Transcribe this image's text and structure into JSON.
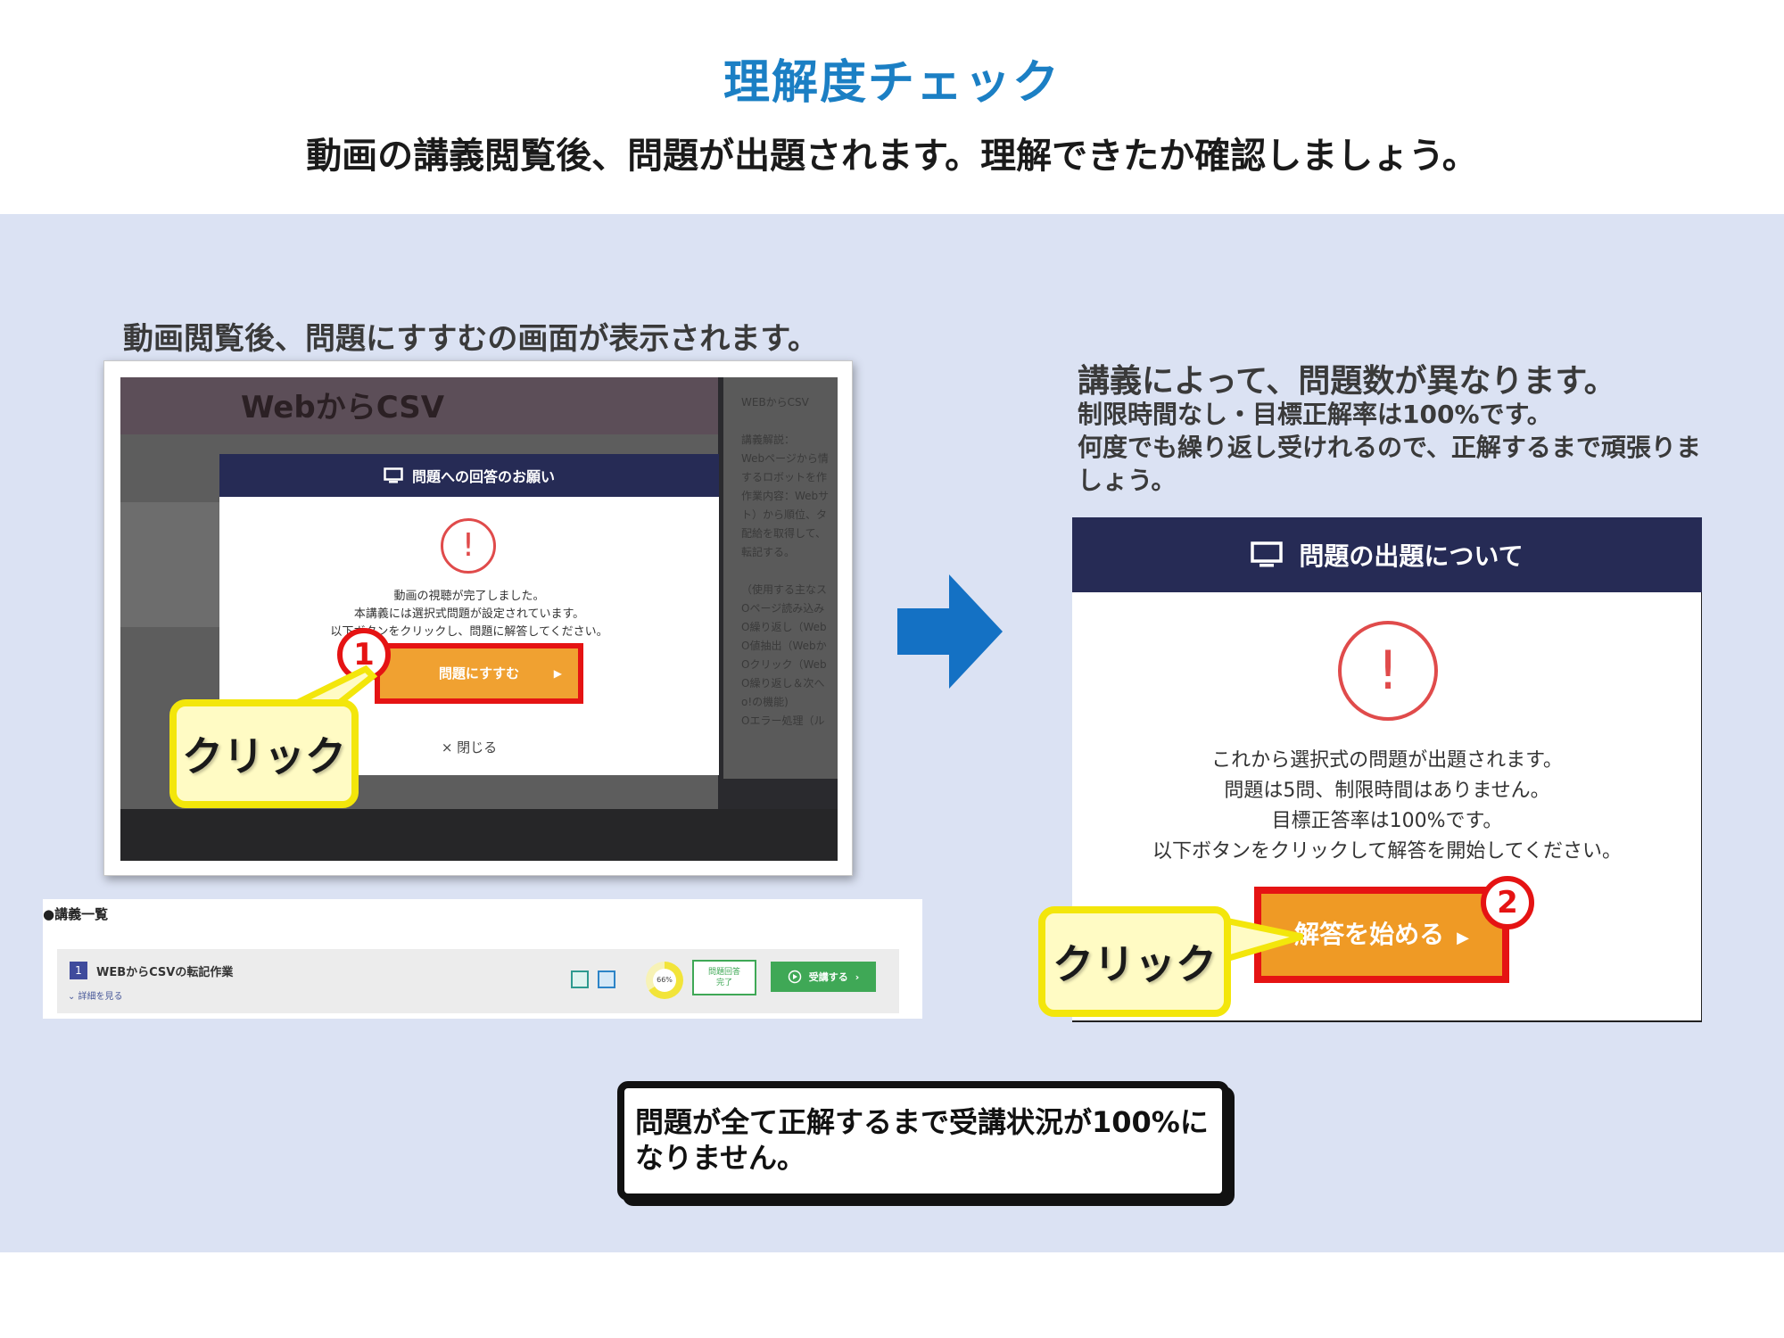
{
  "header": {
    "title": "理解度チェック",
    "subtitle": "動画の講義閲覧後、問題が出題されます。理解できたか確認しましょう。"
  },
  "left": {
    "label": "動画閲覧後、問題にすすむの画面が表示されます。",
    "bg_title": "WebからCSV",
    "bg_side_text": "WEBからCSV\n\n講義解説：\nWebページから情\nするロボットを作\n作業内容：Webサ\nト）から順位、タ\n配給を取得して、\n転記する。\n\n（使用する主なス\nOページ読み込み\nO繰り返し（Web\nO値抽出（Webか\nOクリック（Web\nO繰り返し＆次へ\no!の機能)\nOエラー処理（ル",
    "modal": {
      "header": "問題への回答のお願い",
      "icon": "!",
      "message": [
        "動画の視聴が完了しました。",
        "本講義には選択式問題が設定されています。",
        "以下ボタンをクリックし、問題に解答してください。"
      ],
      "button": "問題にすすむ",
      "close": "× 閉じる"
    },
    "step": "1",
    "callout": "クリック"
  },
  "list": {
    "heading": "●講義一覧",
    "row": {
      "number": "1",
      "title": "WEBからCSVの転記作業",
      "detail": "⌄ 詳細を見る",
      "progress": "66%",
      "progress_value": 0.66,
      "done": "問題回答\n完了",
      "start": "受講する"
    }
  },
  "right": {
    "title": "講義によって、問題数が異なります。",
    "desc": [
      "制限時間なし・目標正解率は100%です。",
      "何度でも繰り返し受けれるので、正解するまで頑張りましょう。"
    ],
    "modal": {
      "header": "問題の出題について",
      "icon": "!",
      "message": [
        "これから選択式の問題が出題されます。",
        "問題は5問、制限時間はありません。",
        "目標正答率は100%です。",
        "以下ボタンをクリックして解答を開始してください。"
      ],
      "button": "解答を始める"
    },
    "step": "2",
    "callout": "クリック"
  },
  "note": "問題が全て正解するまで受講状況が100%になりません。",
  "colors": {
    "title": "#1b7fc4",
    "panel": "#dbe2f3",
    "navy": "#262b55",
    "orange": "#f0a131",
    "red": "#e51313",
    "yellow": "#f3e60b",
    "arrow": "#1471c4"
  }
}
